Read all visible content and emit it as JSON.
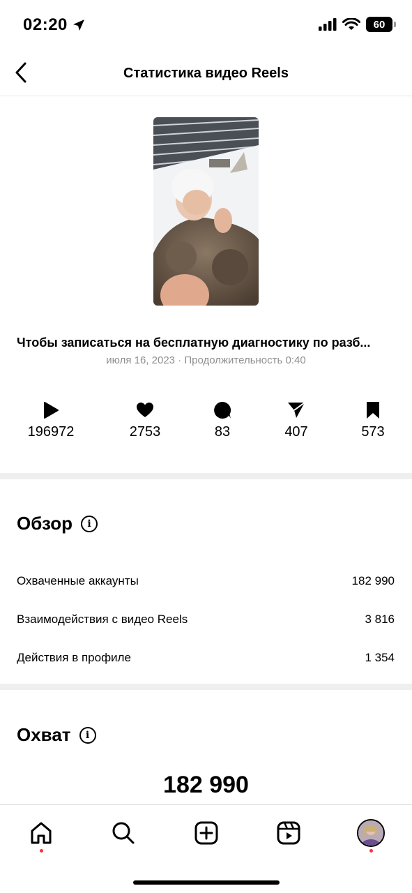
{
  "status_bar": {
    "time": "02:20",
    "battery": "60"
  },
  "header": {
    "title": "Статистика видео Reels"
  },
  "reel": {
    "caption": "Чтобы записаться на бесплатную диагностику по разб...",
    "meta": "июля 16, 2023 · Продолжительность 0:40"
  },
  "stats": [
    {
      "icon": "play-icon",
      "value": "196972"
    },
    {
      "icon": "heart-icon",
      "value": "2753"
    },
    {
      "icon": "comment-icon",
      "value": "83"
    },
    {
      "icon": "send-icon",
      "value": "407"
    },
    {
      "icon": "bookmark-icon",
      "value": "573"
    }
  ],
  "overview": {
    "title": "Обзор",
    "rows": [
      {
        "label": "Охваченные аккаунты",
        "value": "182 990"
      },
      {
        "label": "Взаимодействия с видео Reels",
        "value": "3 816"
      },
      {
        "label": "Действия в профиле",
        "value": "1 354"
      }
    ]
  },
  "reach": {
    "title": "Охват",
    "value": "182 990"
  },
  "nav": [
    "home-icon",
    "search-icon",
    "create-icon",
    "reels-icon",
    "profile-avatar"
  ],
  "colors": {
    "accent_dot": "#ff3040",
    "muted_text": "#8e8e8e",
    "divider": "#efefef"
  }
}
